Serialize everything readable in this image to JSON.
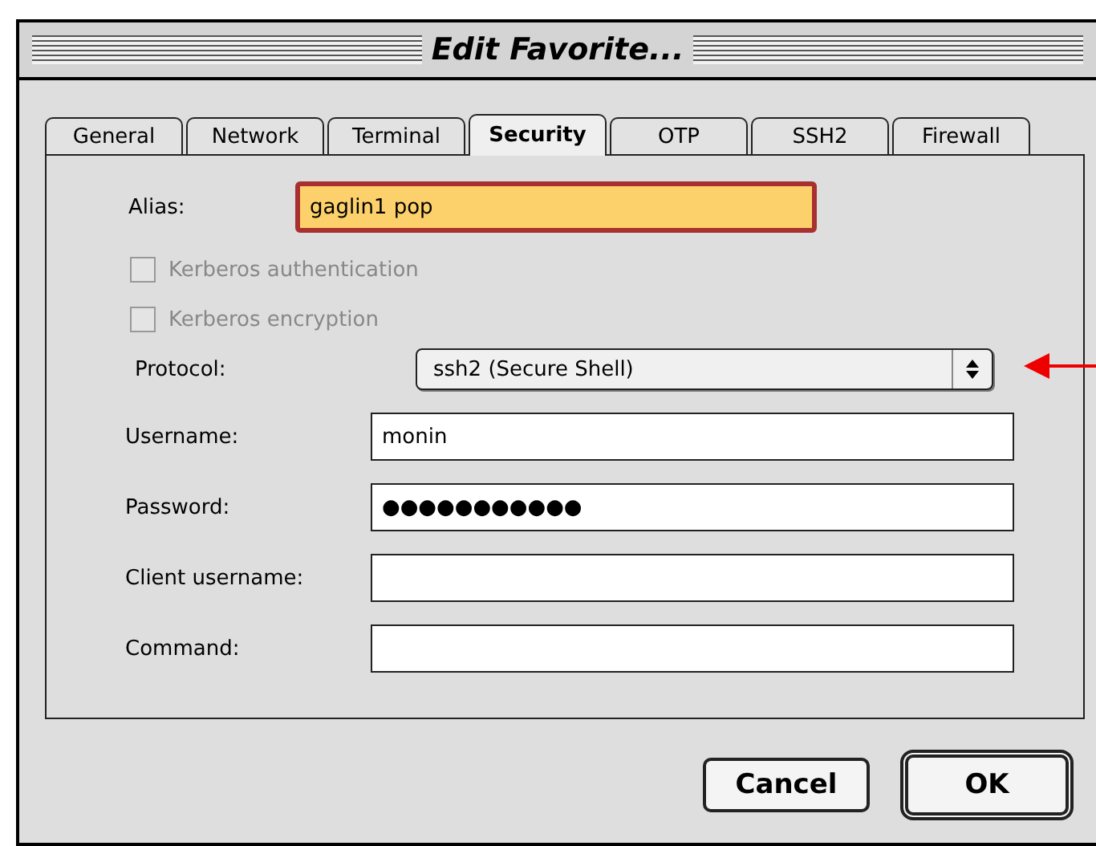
{
  "window": {
    "title": "Edit Favorite..."
  },
  "tabs": [
    {
      "label": "General",
      "selected": false
    },
    {
      "label": "Network",
      "selected": false
    },
    {
      "label": "Terminal",
      "selected": false
    },
    {
      "label": "Security",
      "selected": true
    },
    {
      "label": "OTP",
      "selected": false
    },
    {
      "label": "SSH2",
      "selected": false
    },
    {
      "label": "Firewall",
      "selected": false
    }
  ],
  "rows": [
    {
      "kind": "alias",
      "label": "Alias:",
      "value": "gaglin1 pop",
      "focused": true
    },
    {
      "kind": "checkbox",
      "label": "Kerberos authentication",
      "checked": false,
      "disabled": true
    },
    {
      "kind": "checkbox",
      "label": "Kerberos encryption",
      "checked": false,
      "disabled": true
    },
    {
      "kind": "popup",
      "label": "Protocol:",
      "value": "ssh2 (Secure Shell)"
    },
    {
      "kind": "text",
      "label": "Username:",
      "value": "monin"
    },
    {
      "kind": "text",
      "label": "Password:",
      "value": "●●●●●●●●●●●"
    },
    {
      "kind": "text",
      "label": "Client username:",
      "value": ""
    },
    {
      "kind": "text",
      "label": "Command:",
      "value": ""
    }
  ],
  "buttons": [
    {
      "label": "Cancel",
      "default": false
    },
    {
      "label": "OK",
      "default": true
    }
  ]
}
